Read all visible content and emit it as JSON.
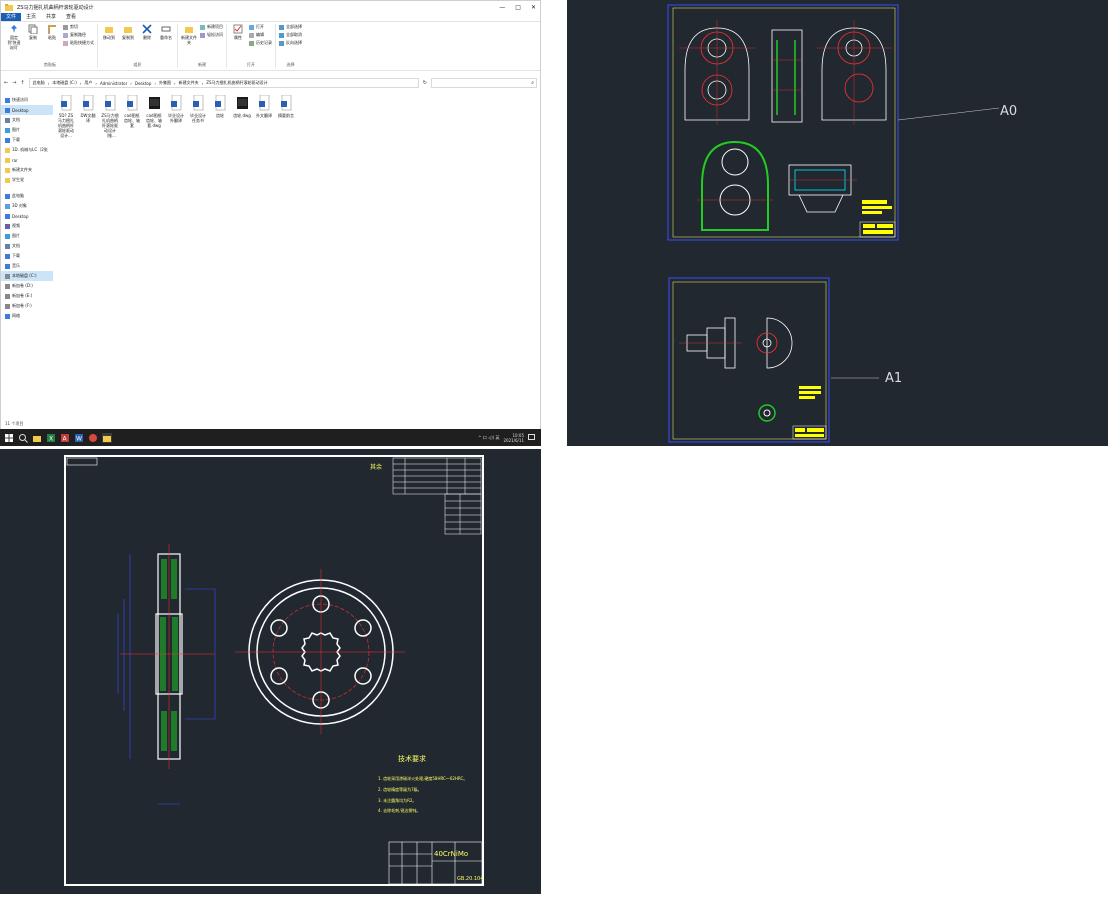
{
  "explorer": {
    "title": "ZS马力捆扎机曲柄杆滚轮驱动设计",
    "window_controls": [
      "—",
      "□",
      "✕"
    ],
    "tabs": [
      "文件",
      "主页",
      "共享",
      "查看"
    ],
    "ribbon": {
      "clipboard": {
        "label": "剪贴板",
        "pin": "固定到'快速访问'",
        "copy": "复制",
        "paste": "粘贴",
        "cut": "剪切",
        "copy_path": "复制路径",
        "paste_shortcut": "粘贴快捷方式"
      },
      "organize": {
        "label": "组织",
        "move_to": "移动到",
        "copy_to": "复制到",
        "delete": "删除",
        "rename": "重命名"
      },
      "new": {
        "label": "新建",
        "new_folder": "新建文件夹",
        "new_item": "新建项目",
        "easy_access": "轻松访问"
      },
      "open": {
        "label": "打开",
        "properties": "属性",
        "open": "打开",
        "edit": "编辑",
        "history": "历史记录"
      },
      "select": {
        "label": "选择",
        "select_all": "全部选择",
        "select_none": "全部取消",
        "invert": "反向选择"
      }
    },
    "address": {
      "segments": [
        "此电脑",
        "本地磁盘 (C:)",
        "用户",
        "Administrator",
        "Desktop",
        "外集图",
        "新建文件夹",
        "ZS马力捆扎机曲柄杆滚轮驱动设计"
      ]
    },
    "nav": {
      "quick": [
        {
          "label": "快速访问",
          "icon": "star-icon"
        },
        {
          "label": "Desktop",
          "icon": "desktop-icon"
        },
        {
          "label": "文档",
          "icon": "document-icon"
        },
        {
          "label": "图片",
          "icon": "picture-icon"
        },
        {
          "label": "下载",
          "icon": "download-icon"
        },
        {
          "label": "1D. 机械与LC（2张",
          "icon": "folder-icon"
        },
        {
          "label": "rar",
          "icon": "folder-icon"
        },
        {
          "label": "新建文件夹",
          "icon": "folder-icon"
        },
        {
          "label": "学生党",
          "icon": "folder-icon"
        }
      ],
      "pc": [
        {
          "label": "此电脑",
          "icon": "computer-icon"
        },
        {
          "label": "3D 对象",
          "icon": "cube-icon"
        },
        {
          "label": "Desktop",
          "icon": "desktop-icon"
        },
        {
          "label": "视频",
          "icon": "video-icon"
        },
        {
          "label": "图片",
          "icon": "picture-icon"
        },
        {
          "label": "文档",
          "icon": "document-icon"
        },
        {
          "label": "下载",
          "icon": "download-icon"
        },
        {
          "label": "音乐",
          "icon": "music-icon"
        },
        {
          "label": "本地磁盘 (C:)",
          "icon": "drive-icon"
        },
        {
          "label": "新加卷 (D:)",
          "icon": "drive-icon"
        },
        {
          "label": "新加卷 (E:)",
          "icon": "drive-icon"
        },
        {
          "label": "新加卷 (F:)",
          "icon": "drive-icon"
        },
        {
          "label": "网络",
          "icon": "network-icon"
        }
      ]
    },
    "files": [
      {
        "name": "5D? ZS马力捆扎机曲柄杆滚轮驱动设计...",
        "kind": "word"
      },
      {
        "name": "DW文翻译",
        "kind": "word"
      },
      {
        "name": "ZS马力捆扎机曲柄杆滚轮驱动设计（推...",
        "kind": "word"
      },
      {
        "name": "cad图纸 齿轮、轴套",
        "kind": "word"
      },
      {
        "name": "cad图纸 齿轮、轴套.dwg",
        "kind": "dwg"
      },
      {
        "name": "毕业设计外翻译",
        "kind": "word"
      },
      {
        "name": "毕业设计任务书",
        "kind": "word"
      },
      {
        "name": "齿轮",
        "kind": "word"
      },
      {
        "name": "齿轮.dwg",
        "kind": "dwg"
      },
      {
        "name": "外文翻译",
        "kind": "word"
      },
      {
        "name": "摘要前言",
        "kind": "word"
      }
    ],
    "status": "11 个项目"
  },
  "taskbar": {
    "apps": [
      "windows-logo-icon",
      "search-icon",
      "file-explorer-icon",
      "excel-icon",
      "autocad-icon",
      "word-icon",
      "media-icon",
      "folder-icon"
    ],
    "tray": "^ 口 ◁)) 英",
    "time": "10:05",
    "date": "2021/6/11"
  },
  "cad_top": {
    "labels": [
      "A0",
      "A1"
    ],
    "colors": {
      "frame": "#3a4cff",
      "drawing": "#ffffff",
      "red": "#ff3030",
      "green": "#22cc22",
      "yellow": "#ffff00",
      "cyan": "#00e5ff"
    }
  },
  "cad_bottom": {
    "material": "40CrNiMo",
    "tech_title": "技术要求",
    "tech_lines": [
      "1. 齿轮采用渗碳淬火处理,硬度58HRC～62HRC。",
      "2. 齿轮精度等级为7级。",
      "3. 未注圆角均为R2。",
      "4. 去除毛刺,锐边倒钝。"
    ],
    "roughness_label": "其余",
    "drawing_no": "GB.20.104"
  }
}
